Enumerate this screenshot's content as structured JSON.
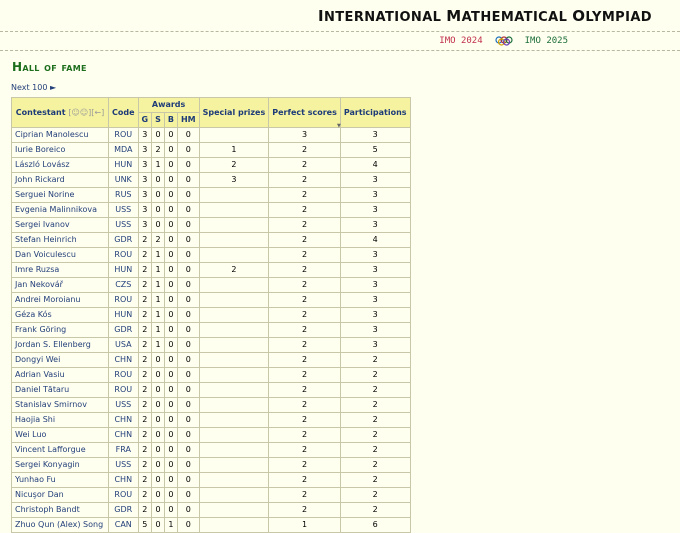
{
  "site_title_first": "I",
  "site_title_rest": "NTERNATIONAL ",
  "site_title_m": "M",
  "site_title_rest2": "ATHEMATICAL ",
  "site_title_o": "O",
  "site_title_rest3": "LYMPIAD",
  "nav": {
    "prev": "IMO 2024",
    "next": "IMO 2025",
    "rings_icon": "olympic-rings-icon"
  },
  "heading": "Hall of fame",
  "next_link": "Next 100 ►",
  "table": {
    "headers": {
      "contestant": "Contestant",
      "sort_hint": "[☺☺]",
      "sort_arrow": "[←]",
      "code": "Code",
      "awards": "Awards",
      "g": "G",
      "s": "S",
      "b": "B",
      "hm": "HM",
      "special": "Special prizes",
      "perfect": "Perfect scores",
      "participations": "Participations"
    },
    "rows": [
      {
        "name": "Ciprian Manolescu",
        "code": "ROU",
        "g": "3",
        "s": "0",
        "b": "0",
        "hm": "0",
        "sp": "",
        "ps": "3",
        "pa": "3"
      },
      {
        "name": "Iurie Boreico",
        "code": "MDA",
        "g": "3",
        "s": "2",
        "b": "0",
        "hm": "0",
        "sp": "1",
        "ps": "2",
        "pa": "5"
      },
      {
        "name": "László Lovász",
        "code": "HUN",
        "g": "3",
        "s": "1",
        "b": "0",
        "hm": "0",
        "sp": "2",
        "ps": "2",
        "pa": "4"
      },
      {
        "name": "John Rickard",
        "code": "UNK",
        "g": "3",
        "s": "0",
        "b": "0",
        "hm": "0",
        "sp": "3",
        "ps": "2",
        "pa": "3"
      },
      {
        "name": "Serguei Norine",
        "code": "RUS",
        "g": "3",
        "s": "0",
        "b": "0",
        "hm": "0",
        "sp": "",
        "ps": "2",
        "pa": "3"
      },
      {
        "name": "Evgenia Malinnikova",
        "code": "USS",
        "g": "3",
        "s": "0",
        "b": "0",
        "hm": "0",
        "sp": "",
        "ps": "2",
        "pa": "3"
      },
      {
        "name": "Sergei Ivanov",
        "code": "USS",
        "g": "3",
        "s": "0",
        "b": "0",
        "hm": "0",
        "sp": "",
        "ps": "2",
        "pa": "3"
      },
      {
        "name": "Stefan Heinrich",
        "code": "GDR",
        "g": "2",
        "s": "2",
        "b": "0",
        "hm": "0",
        "sp": "",
        "ps": "2",
        "pa": "4"
      },
      {
        "name": "Dan Voiculescu",
        "code": "ROU",
        "g": "2",
        "s": "1",
        "b": "0",
        "hm": "0",
        "sp": "",
        "ps": "2",
        "pa": "3"
      },
      {
        "name": "Imre Ruzsa",
        "code": "HUN",
        "g": "2",
        "s": "1",
        "b": "0",
        "hm": "0",
        "sp": "2",
        "ps": "2",
        "pa": "3"
      },
      {
        "name": "Jan Nekovář",
        "code": "CZS",
        "g": "2",
        "s": "1",
        "b": "0",
        "hm": "0",
        "sp": "",
        "ps": "2",
        "pa": "3"
      },
      {
        "name": "Andrei Moroianu",
        "code": "ROU",
        "g": "2",
        "s": "1",
        "b": "0",
        "hm": "0",
        "sp": "",
        "ps": "2",
        "pa": "3"
      },
      {
        "name": "Géza Kós",
        "code": "HUN",
        "g": "2",
        "s": "1",
        "b": "0",
        "hm": "0",
        "sp": "",
        "ps": "2",
        "pa": "3"
      },
      {
        "name": "Frank Göring",
        "code": "GDR",
        "g": "2",
        "s": "1",
        "b": "0",
        "hm": "0",
        "sp": "",
        "ps": "2",
        "pa": "3"
      },
      {
        "name": "Jordan S. Ellenberg",
        "code": "USA",
        "g": "2",
        "s": "1",
        "b": "0",
        "hm": "0",
        "sp": "",
        "ps": "2",
        "pa": "3"
      },
      {
        "name": "Dongyi Wei",
        "code": "CHN",
        "g": "2",
        "s": "0",
        "b": "0",
        "hm": "0",
        "sp": "",
        "ps": "2",
        "pa": "2"
      },
      {
        "name": "Adrian Vasiu",
        "code": "ROU",
        "g": "2",
        "s": "0",
        "b": "0",
        "hm": "0",
        "sp": "",
        "ps": "2",
        "pa": "2"
      },
      {
        "name": "Daniel Tătaru",
        "code": "ROU",
        "g": "2",
        "s": "0",
        "b": "0",
        "hm": "0",
        "sp": "",
        "ps": "2",
        "pa": "2"
      },
      {
        "name": "Stanislav Smirnov",
        "code": "USS",
        "g": "2",
        "s": "0",
        "b": "0",
        "hm": "0",
        "sp": "",
        "ps": "2",
        "pa": "2"
      },
      {
        "name": "Haojia Shi",
        "code": "CHN",
        "g": "2",
        "s": "0",
        "b": "0",
        "hm": "0",
        "sp": "",
        "ps": "2",
        "pa": "2"
      },
      {
        "name": "Wei Luo",
        "code": "CHN",
        "g": "2",
        "s": "0",
        "b": "0",
        "hm": "0",
        "sp": "",
        "ps": "2",
        "pa": "2"
      },
      {
        "name": "Vincent Lafforgue",
        "code": "FRA",
        "g": "2",
        "s": "0",
        "b": "0",
        "hm": "0",
        "sp": "",
        "ps": "2",
        "pa": "2"
      },
      {
        "name": "Sergei Konyagin",
        "code": "USS",
        "g": "2",
        "s": "0",
        "b": "0",
        "hm": "0",
        "sp": "",
        "ps": "2",
        "pa": "2"
      },
      {
        "name": "Yunhao Fu",
        "code": "CHN",
        "g": "2",
        "s": "0",
        "b": "0",
        "hm": "0",
        "sp": "",
        "ps": "2",
        "pa": "2"
      },
      {
        "name": "Nicuşor Dan",
        "code": "ROU",
        "g": "2",
        "s": "0",
        "b": "0",
        "hm": "0",
        "sp": "",
        "ps": "2",
        "pa": "2"
      },
      {
        "name": "Christoph Bandt",
        "code": "GDR",
        "g": "2",
        "s": "0",
        "b": "0",
        "hm": "0",
        "sp": "",
        "ps": "2",
        "pa": "2"
      },
      {
        "name": "Zhuo Qun (Alex) Song",
        "code": "CAN",
        "g": "5",
        "s": "0",
        "b": "1",
        "hm": "0",
        "sp": "",
        "ps": "1",
        "pa": "6"
      }
    ]
  },
  "colors": {
    "background": "#fffff0",
    "header_bg": "#f6f3a0",
    "link": "#24407a",
    "heading": "#1d6f1d",
    "prev": "#c0304c",
    "next": "#1d6f3a"
  }
}
